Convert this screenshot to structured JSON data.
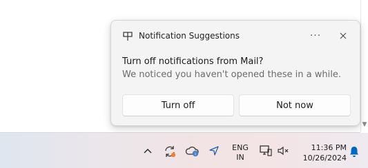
{
  "notification": {
    "app_name": "Notification Suggestions",
    "more_glyph": "···",
    "title": "Turn off notifications from Mail?",
    "body": "We noticed you haven't opened these in a while.",
    "primary_button": "Turn off",
    "secondary_button": "Not now",
    "icons": {
      "app": "notification-suggestions-icon",
      "more": "more-options-icon",
      "close": "close-icon"
    }
  },
  "taskbar": {
    "language_line1": "ENG",
    "language_line2": "IN",
    "time": "11:36 PM",
    "date": "10/26/2024",
    "icons": [
      "chevron-up-icon",
      "sync-icon",
      "onedrive-icon",
      "location-icon",
      "network-icon",
      "volume-muted-icon",
      "notification-bell-icon"
    ]
  },
  "colors": {
    "accent_blue": "#0067c0",
    "badge_orange": "#e8843a",
    "cloud_blue": "#4a7fc1"
  }
}
